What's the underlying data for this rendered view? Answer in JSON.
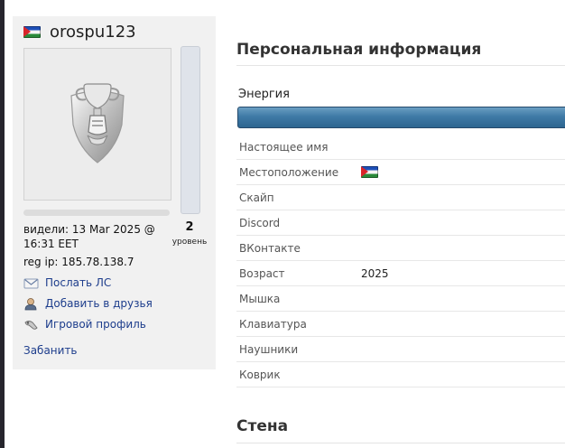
{
  "profile": {
    "username": "orospu123",
    "level_number": "2",
    "level_label": "уровень",
    "last_seen": "видели: 13 Mar 2025 @ 16:31 EET",
    "reg_ip": "reg ip: 185.78.138.7",
    "actions": [
      {
        "label": "Послать ЛС",
        "icon": "envelope-icon"
      },
      {
        "label": "Добавить в друзья",
        "icon": "add-friend-icon"
      },
      {
        "label": "Игровой профиль",
        "icon": "game-profile-icon"
      }
    ],
    "ban_label": "Забанить",
    "flag_icon": "flag-icon"
  },
  "personal": {
    "title": "Персональная информация",
    "energy_label": "Энергия",
    "energy_fill": 1.0,
    "fields": [
      {
        "label": "Настоящее имя",
        "value": ""
      },
      {
        "label": "Местоположение",
        "value": ""
      },
      {
        "label": "Скайп",
        "value": ""
      },
      {
        "label": "Discord",
        "value": ""
      },
      {
        "label": "ВКонтакте",
        "value": ""
      },
      {
        "label": "Возраст",
        "value": "2025"
      },
      {
        "label": "Мышка",
        "value": ""
      },
      {
        "label": "Клавиатура",
        "value": ""
      },
      {
        "label": "Наушники",
        "value": ""
      },
      {
        "label": "Коврик",
        "value": ""
      }
    ]
  },
  "wall": {
    "title": "Стена"
  },
  "colors": {
    "panel_bg": "#f1f1f1",
    "link": "#1d3d8c",
    "energy_bar": "#3f7aa6"
  }
}
